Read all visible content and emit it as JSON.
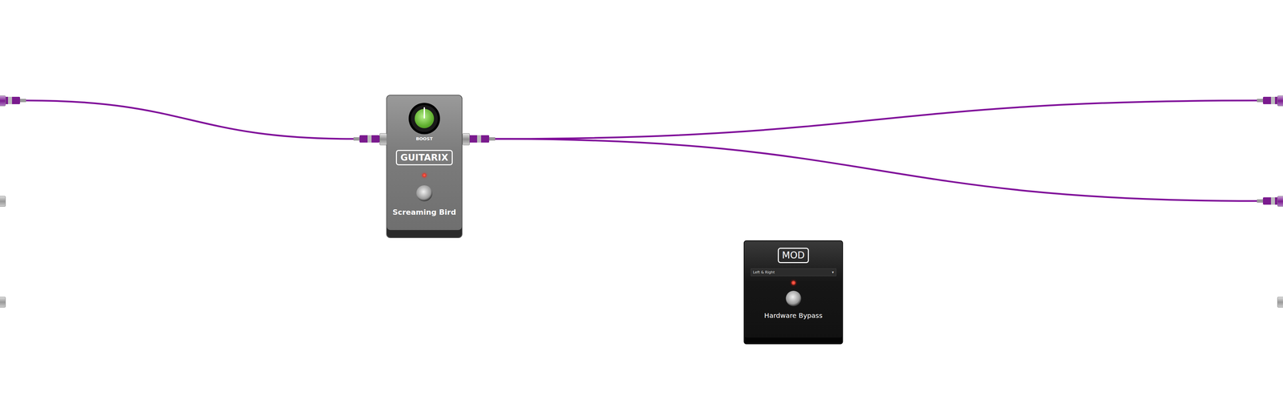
{
  "system": {
    "inputs": [
      {
        "connected": true
      },
      {
        "connected": false
      },
      {
        "connected": false
      }
    ],
    "outputs": [
      {
        "connected": true
      },
      {
        "connected": true
      },
      {
        "connected": false
      }
    ]
  },
  "pedals": [
    {
      "kind": "guitarix",
      "brand": "GUITARIX",
      "name": "Screaming Bird",
      "knob": {
        "label": "BOOST",
        "level": 0.5
      },
      "on": true
    },
    {
      "kind": "mod",
      "brand": "MOD",
      "name": "Hardware Bypass",
      "dropdown": {
        "value": "Left & Right",
        "arrow": "▾"
      },
      "on": true
    }
  ],
  "cables": [
    {
      "from": "system-input-0",
      "to": "pedal-0-input"
    },
    {
      "from": "pedal-0-output",
      "to": "system-output-0"
    },
    {
      "from": "pedal-0-output",
      "to": "system-output-1"
    }
  ]
}
